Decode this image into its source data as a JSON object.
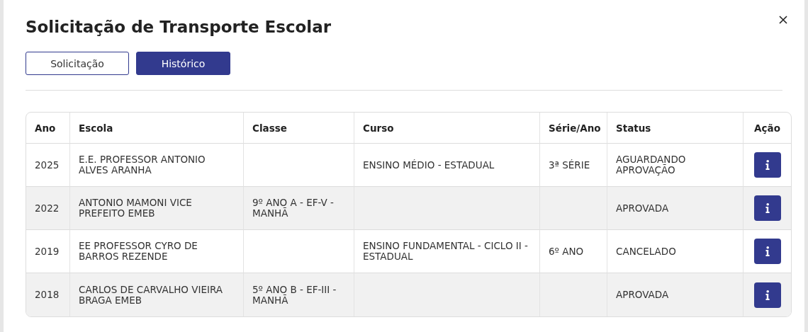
{
  "dialog": {
    "title": "Solicitação de Transporte Escolar"
  },
  "tabs": [
    {
      "label": "Solicitação",
      "selected": false
    },
    {
      "label": "Histórico",
      "selected": true
    }
  ],
  "table": {
    "columns": [
      "Ano",
      "Escola",
      "Classe",
      "Curso",
      "Série/Ano",
      "Status",
      "Ação"
    ],
    "rows": [
      {
        "ano": "2025",
        "escola": "E.E. PROFESSOR ANTONIO ALVES ARANHA",
        "classe": "",
        "curso": "ENSINO MÉDIO - ESTADUAL",
        "serie": "3ª SÉRIE",
        "status": "AGUARDANDO APROVAÇÃO"
      },
      {
        "ano": "2022",
        "escola": "ANTONIO MAMONI VICE PREFEITO EMEB",
        "classe": "9º ANO A - EF-V - MANHÃ",
        "curso": "",
        "serie": "",
        "status": "APROVADA"
      },
      {
        "ano": "2019",
        "escola": "EE PROFESSOR CYRO DE BARROS REZENDE",
        "classe": "",
        "curso": "ENSINO FUNDAMENTAL - CICLO II - ESTADUAL",
        "serie": "6º ANO",
        "status": "CANCELADO"
      },
      {
        "ano": "2018",
        "escola": "CARLOS DE CARVALHO VIEIRA BRAGA EMEB",
        "classe": "5º ANO B - EF-III - MANHÃ",
        "curso": "",
        "serie": "",
        "status": "APROVADA"
      }
    ]
  }
}
